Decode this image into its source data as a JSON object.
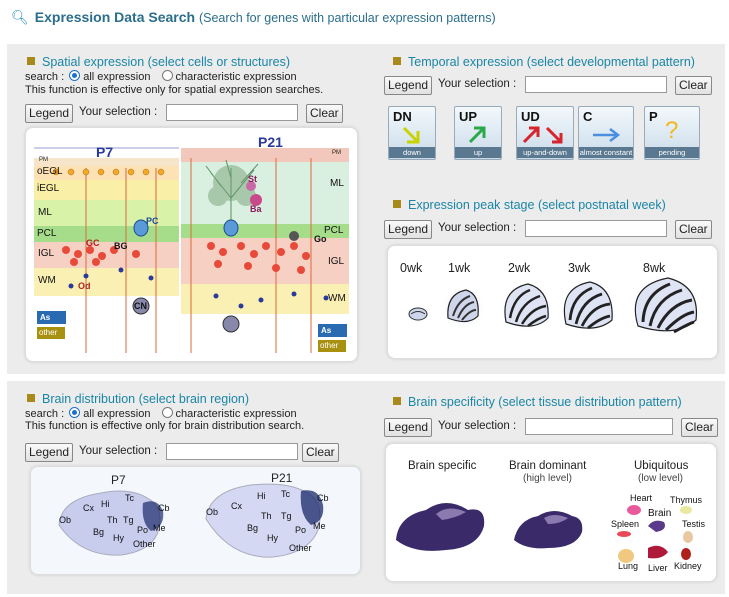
{
  "header": {
    "title": "Expression Data Search",
    "subtitle": "(Search for genes with particular expression patterns)"
  },
  "common": {
    "legend": "Legend",
    "your_selection": "Your selection :",
    "clear": "Clear",
    "search": "search :",
    "all_expression": "all expression",
    "characteristic_expression": "characteristic expression"
  },
  "spatial": {
    "title": "Spatial expression (select cells or structures)",
    "note": "This function is effective only for spatial expression searches.",
    "ages": [
      "P7",
      "P21"
    ],
    "layers": [
      "PM",
      "oEGL",
      "iEGL",
      "ML",
      "PCL",
      "IGL",
      "WM"
    ],
    "layers_right": [
      "PM",
      "ML",
      "PCL",
      "IGL",
      "WM"
    ],
    "cells": [
      "PC",
      "GC",
      "BG",
      "Od",
      "CN",
      "St",
      "Ba",
      "Go",
      "As",
      "other"
    ]
  },
  "temporal": {
    "title": "Temporal expression (select developmental pattern)",
    "patterns": [
      {
        "code": "DN",
        "label": "down",
        "color": "#c8d400"
      },
      {
        "code": "UP",
        "label": "up",
        "color": "#2aa84a"
      },
      {
        "code": "UD",
        "label": "up-and-down",
        "color": "#d8242c"
      },
      {
        "code": "C",
        "label": "almost constant",
        "color": "#4a8fe0"
      },
      {
        "code": "P",
        "label": "pending",
        "color": "#f2b820"
      }
    ]
  },
  "peak": {
    "title": "Expression peak stage (select postnatal week)",
    "weeks": [
      "0wk",
      "1wk",
      "2wk",
      "3wk",
      "8wk"
    ]
  },
  "distribution": {
    "title": "Brain distribution (select brain region)",
    "note": "This function is effective only for brain distribution search.",
    "ages": [
      "P7",
      "P21"
    ],
    "regions": [
      "Ob",
      "Cx",
      "Hi",
      "Tc",
      "Cb",
      "Th",
      "Tg",
      "Bg",
      "Hy",
      "Po",
      "Me",
      "Other"
    ]
  },
  "specificity": {
    "title": "Brain specificity (select tissue distribution pattern)",
    "brain_specific": "Brain specific",
    "brain_dominant": "Brain dominant",
    "brain_dominant_sub": "(high level)",
    "ubiquitous": "Ubiquitous",
    "ubiquitous_sub": "(low level)",
    "organs": [
      "Heart",
      "Thymus",
      "Brain",
      "Spleen",
      "Testis",
      "Lung",
      "Liver",
      "Kidney"
    ]
  }
}
